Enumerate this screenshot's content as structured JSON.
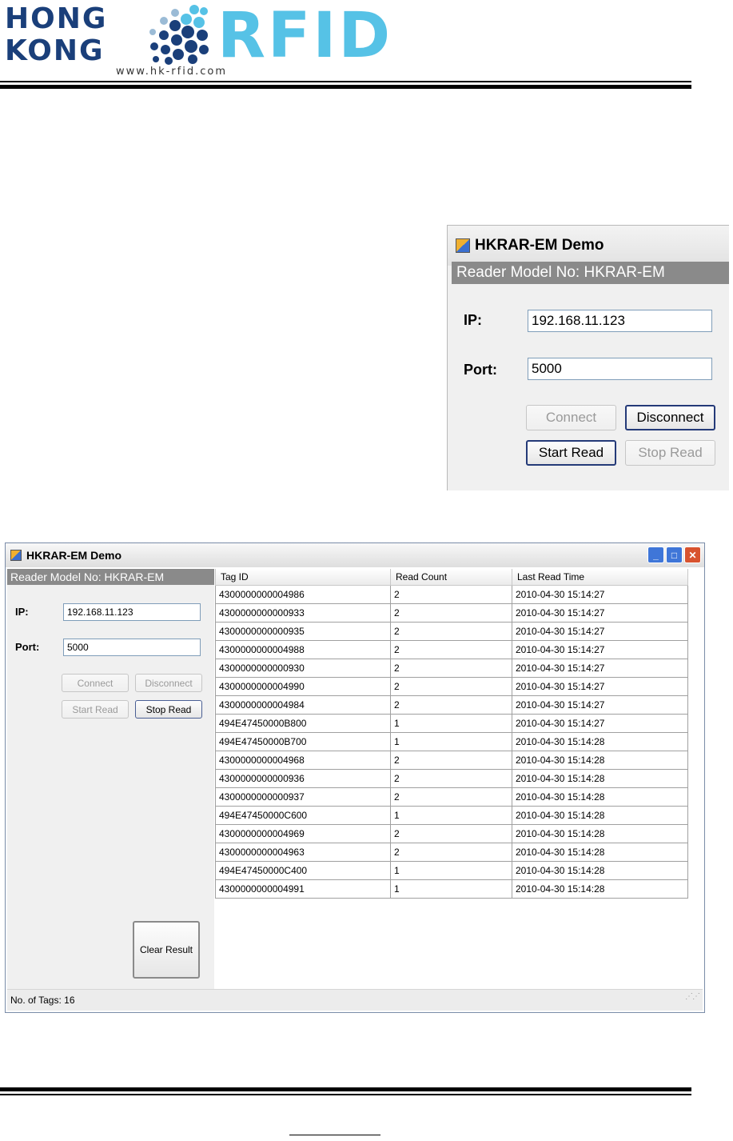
{
  "logo": {
    "line1": "HONG",
    "line2": "KONG",
    "brand": "RFID",
    "url": "www.hk-rfid.com",
    "colors": {
      "navy": "#1a3f7a",
      "cyan": "#56c2e6"
    }
  },
  "zoom_window": {
    "title": "HKRAR-EM Demo",
    "reader_model": "Reader Model No: HKRAR-EM",
    "ip_label": "IP:",
    "ip_value": "192.168.11.123",
    "port_label": "Port:",
    "port_value": "5000",
    "connect_label": "Connect",
    "disconnect_label": "Disconnect",
    "start_read_label": "Start Read",
    "stop_read_label": "Stop Read"
  },
  "main_window": {
    "title": "HKRAR-EM Demo",
    "window_controls": [
      "minimize-icon",
      "maximize-icon",
      "close-icon"
    ],
    "reader_model": "Reader Model No: HKRAR-EM",
    "ip_label": "IP:",
    "ip_value": "192.168.11.123",
    "port_label": "Port:",
    "port_value": "5000",
    "connect_label": "Connect",
    "disconnect_label": "Disconnect",
    "start_read_label": "Start Read",
    "stop_read_label": "Stop Read",
    "clear_result_label": "Clear Result",
    "status_text": "No. of Tags: 16",
    "table": {
      "columns": [
        "Tag ID",
        "Read Count",
        "Last Read Time"
      ],
      "rows": [
        [
          "4300000000004986",
          "2",
          "2010-04-30 15:14:27"
        ],
        [
          "4300000000000933",
          "2",
          "2010-04-30 15:14:27"
        ],
        [
          "4300000000000935",
          "2",
          "2010-04-30 15:14:27"
        ],
        [
          "4300000000004988",
          "2",
          "2010-04-30 15:14:27"
        ],
        [
          "4300000000000930",
          "2",
          "2010-04-30 15:14:27"
        ],
        [
          "4300000000004990",
          "2",
          "2010-04-30 15:14:27"
        ],
        [
          "4300000000004984",
          "2",
          "2010-04-30 15:14:27"
        ],
        [
          "494E47450000B800",
          "1",
          "2010-04-30 15:14:27"
        ],
        [
          "494E47450000B700",
          "1",
          "2010-04-30 15:14:28"
        ],
        [
          "4300000000004968",
          "2",
          "2010-04-30 15:14:28"
        ],
        [
          "4300000000000936",
          "2",
          "2010-04-30 15:14:28"
        ],
        [
          "4300000000000937",
          "2",
          "2010-04-30 15:14:28"
        ],
        [
          "494E47450000C600",
          "1",
          "2010-04-30 15:14:28"
        ],
        [
          "4300000000004969",
          "2",
          "2010-04-30 15:14:28"
        ],
        [
          "4300000000004963",
          "2",
          "2010-04-30 15:14:28"
        ],
        [
          "494E47450000C400",
          "1",
          "2010-04-30 15:14:28"
        ],
        [
          "4300000000004991",
          "1",
          "2010-04-30 15:14:28"
        ]
      ]
    }
  }
}
